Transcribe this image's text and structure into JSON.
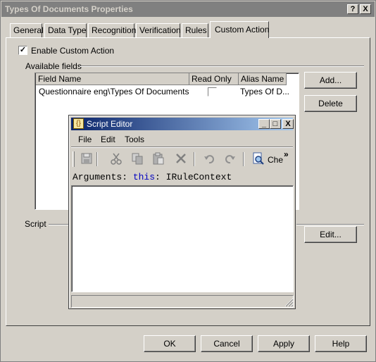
{
  "window": {
    "title": "Types Of Documents Properties",
    "help_btn": "?",
    "close_btn": "X"
  },
  "tabs": [
    {
      "label": "General"
    },
    {
      "label": "Data Type"
    },
    {
      "label": "Recognition"
    },
    {
      "label": "Verification"
    },
    {
      "label": "Rules"
    },
    {
      "label": "Custom Action",
      "active": true
    }
  ],
  "enable_custom_action": {
    "label": "Enable Custom Action",
    "checked": true,
    "mark": "✓"
  },
  "available_fields": {
    "group_label": "Available fields",
    "columns": [
      "Field Name",
      "Read Only",
      "Alias Name"
    ],
    "rows": [
      {
        "field_name": "Questionnaire eng\\Types Of Documents",
        "read_only": false,
        "alias_name": "Types Of D..."
      }
    ],
    "add_button": "Add...",
    "delete_button": "Delete"
  },
  "script": {
    "group_label": "Script",
    "edit_button": "Edit..."
  },
  "footer": {
    "ok": "OK",
    "cancel": "Cancel",
    "apply": "Apply",
    "help": "Help"
  },
  "script_editor": {
    "title": "Script Editor",
    "minimize": "_",
    "maximize": "□",
    "close": "X",
    "menu": [
      "File",
      "Edit",
      "Tools"
    ],
    "toolbar_overflow": "»",
    "check_label": "Che",
    "code": {
      "keyword": "Arguments:",
      "this_kw": "this",
      "type": ": IRuleContext"
    }
  },
  "colors": {
    "face": "#d4d0c8",
    "title_inactive": "#808080",
    "title_active_start": "#0a246a",
    "title_active_end": "#a6caf0",
    "keyword_blue": "#0000c0"
  }
}
